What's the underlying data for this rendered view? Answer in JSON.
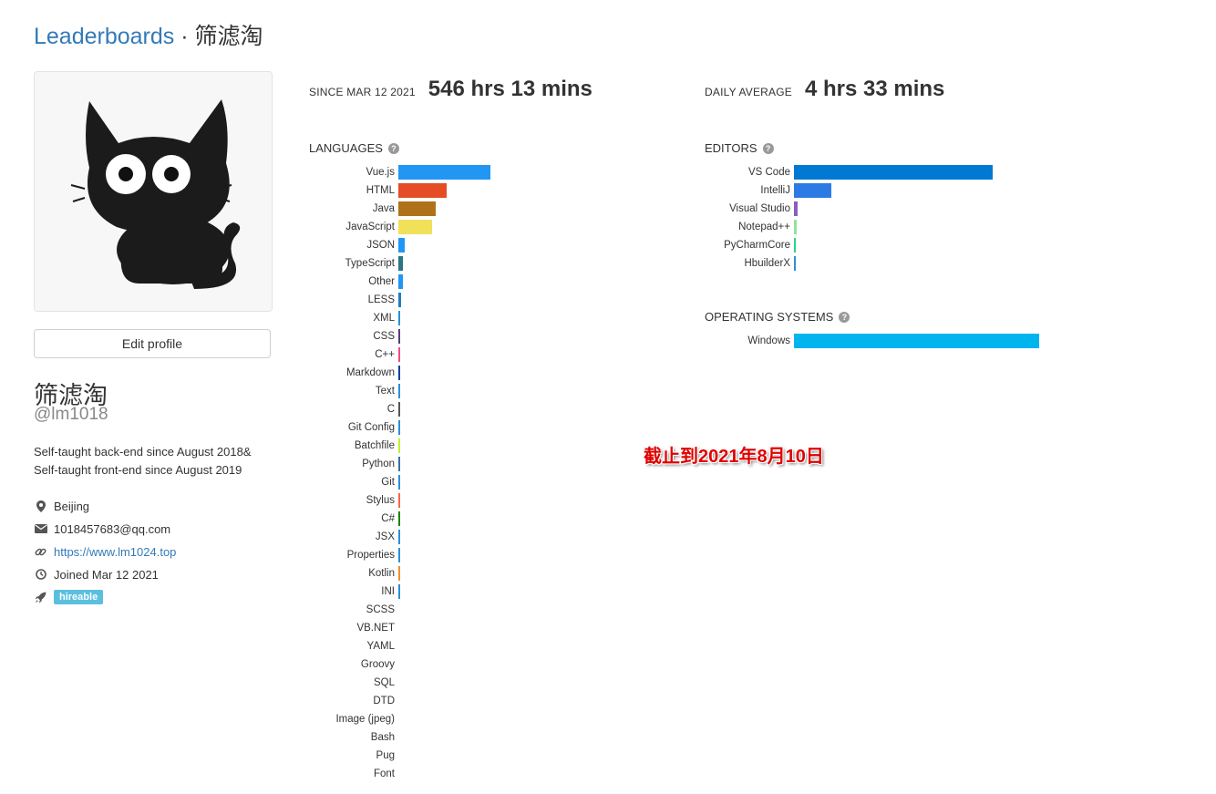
{
  "breadcrumb": {
    "link": "Leaderboards",
    "separator": " · ",
    "current": "筛滤淘"
  },
  "profile": {
    "edit_label": "Edit profile",
    "display_name": "筛滤淘",
    "username": "@lm1018",
    "bio_lines": [
      "Self-taught back-end since August 2018&",
      "Self-taught front-end since August 2019"
    ],
    "location": "Beijing",
    "email": "1018457683@qq.com",
    "website": "https://www.lm1024.top",
    "joined": "Joined Mar 12 2021",
    "badge": "hireable",
    "badge_color": "#5bc0de"
  },
  "stats": {
    "total_label": "SINCE MAR 12 2021",
    "total_value": "546 hrs 13 mins",
    "daily_label": "DAILY AVERAGE",
    "daily_value": "4 hrs 33 mins"
  },
  "sections": {
    "languages": "LANGUAGES",
    "editors": "EDITORS",
    "os": "OPERATING SYSTEMS",
    "help_icon": "question-circle-icon"
  },
  "languages": [
    {
      "name": "Vue.js",
      "share": 0.465,
      "color": "#2196f3"
    },
    {
      "name": "HTML",
      "share": 0.245,
      "color": "#e44d26"
    },
    {
      "name": "Java",
      "share": 0.19,
      "color": "#b07219"
    },
    {
      "name": "JavaScript",
      "share": 0.17,
      "color": "#f1e05a"
    },
    {
      "name": "JSON",
      "share": 0.03,
      "color": "#2196f3"
    },
    {
      "name": "TypeScript",
      "share": 0.025,
      "color": "#2b7489"
    },
    {
      "name": "Other",
      "share": 0.022,
      "color": "#2196f3"
    },
    {
      "name": "LESS",
      "share": 0.012,
      "color": "#1d7fc1"
    },
    {
      "name": "XML",
      "share": 0.011,
      "color": "#2a8fdb"
    },
    {
      "name": "CSS",
      "share": 0.01,
      "color": "#563d7c"
    },
    {
      "name": "C++",
      "share": 0.009,
      "color": "#f34b7d"
    },
    {
      "name": "Markdown",
      "share": 0.008,
      "color": "#083fa1"
    },
    {
      "name": "Text",
      "share": 0.006,
      "color": "#2a8fdb"
    },
    {
      "name": "C",
      "share": 0.006,
      "color": "#555555"
    },
    {
      "name": "Git Config",
      "share": 0.005,
      "color": "#2a8fdb"
    },
    {
      "name": "Batchfile",
      "share": 0.005,
      "color": "#c1f12e"
    },
    {
      "name": "Python",
      "share": 0.004,
      "color": "#3572a5"
    },
    {
      "name": "Git",
      "share": 0.004,
      "color": "#2a8fdb"
    },
    {
      "name": "Stylus",
      "share": 0.004,
      "color": "#ff6347"
    },
    {
      "name": "C#",
      "share": 0.003,
      "color": "#178600"
    },
    {
      "name": "JSX",
      "share": 0.003,
      "color": "#2a8fdb"
    },
    {
      "name": "Properties",
      "share": 0.003,
      "color": "#2a8fdb"
    },
    {
      "name": "Kotlin",
      "share": 0.003,
      "color": "#f18e33"
    },
    {
      "name": "INI",
      "share": 0.002,
      "color": "#2a8fdb"
    },
    {
      "name": "SCSS",
      "share": 0,
      "color": "#c6538c"
    },
    {
      "name": "VB.NET",
      "share": 0,
      "color": "#945db7"
    },
    {
      "name": "YAML",
      "share": 0,
      "color": "#cb171e"
    },
    {
      "name": "Groovy",
      "share": 0,
      "color": "#e69f56"
    },
    {
      "name": "SQL",
      "share": 0,
      "color": "#2a8fdb"
    },
    {
      "name": "DTD",
      "share": 0,
      "color": "#2a8fdb"
    },
    {
      "name": "Image (jpeg)",
      "share": 0,
      "color": "#2a8fdb"
    },
    {
      "name": "Bash",
      "share": 0,
      "color": "#89e051"
    },
    {
      "name": "Pug",
      "share": 0,
      "color": "#a86454"
    },
    {
      "name": "Font",
      "share": 0,
      "color": "#2a8fdb"
    }
  ],
  "editors": [
    {
      "name": "VS Code",
      "share": 1.0,
      "color": "#0078d4"
    },
    {
      "name": "IntelliJ",
      "share": 0.19,
      "color": "#2c7be5"
    },
    {
      "name": "Visual Studio",
      "share": 0.02,
      "color": "#865fc5"
    },
    {
      "name": "Notepad++",
      "share": 0.015,
      "color": "#90e59a"
    },
    {
      "name": "PyCharmCore",
      "share": 0.005,
      "color": "#21d789"
    },
    {
      "name": "HbuilderX",
      "share": 0.005,
      "color": "#2a8fdb"
    }
  ],
  "operating_systems": [
    {
      "name": "Windows",
      "share": 1.0,
      "color": "#00b4f0"
    }
  ],
  "annotation": "截止到2021年8月10日"
}
